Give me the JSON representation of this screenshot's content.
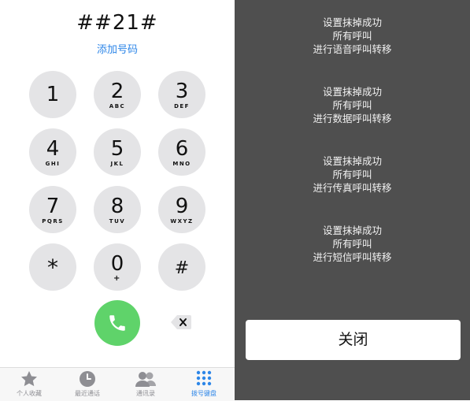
{
  "dialer": {
    "number": "##21#",
    "add_number": "添加号码",
    "keys": [
      {
        "digit": "1",
        "letters": ""
      },
      {
        "digit": "2",
        "letters": "ABC"
      },
      {
        "digit": "3",
        "letters": "DEF"
      },
      {
        "digit": "4",
        "letters": "GHI"
      },
      {
        "digit": "5",
        "letters": "JKL"
      },
      {
        "digit": "6",
        "letters": "MNO"
      },
      {
        "digit": "7",
        "letters": "PQRS"
      },
      {
        "digit": "8",
        "letters": "TUV"
      },
      {
        "digit": "9",
        "letters": "WXYZ"
      },
      {
        "digit": "*",
        "letters": ""
      },
      {
        "digit": "0",
        "letters": "+"
      },
      {
        "digit": "#",
        "letters": ""
      }
    ],
    "call_icon": "phone-icon",
    "backspace_icon": "backspace-icon",
    "call_color": "#5fd36a"
  },
  "tabbar": {
    "tabs": [
      {
        "label": "个人收藏",
        "icon": "star-icon"
      },
      {
        "label": "最近通话",
        "icon": "clock-icon"
      },
      {
        "label": "通讯录",
        "icon": "contacts-icon"
      },
      {
        "label": "拨号键盘",
        "icon": "keypad-icon",
        "active": true
      }
    ],
    "active_color": "#2d86e8"
  },
  "dialog": {
    "messages": [
      {
        "line1": "设置抹掉成功",
        "line2": "所有呼叫",
        "line3": "进行语音呼叫转移"
      },
      {
        "line1": "设置抹掉成功",
        "line2": "所有呼叫",
        "line3": "进行数据呼叫转移"
      },
      {
        "line1": "设置抹掉成功",
        "line2": "所有呼叫",
        "line3": "进行传真呼叫转移"
      },
      {
        "line1": "设置抹掉成功",
        "line2": "所有呼叫",
        "line3": "进行短信呼叫转移"
      }
    ],
    "close_label": "关闭",
    "background": "#4f4f4f"
  }
}
